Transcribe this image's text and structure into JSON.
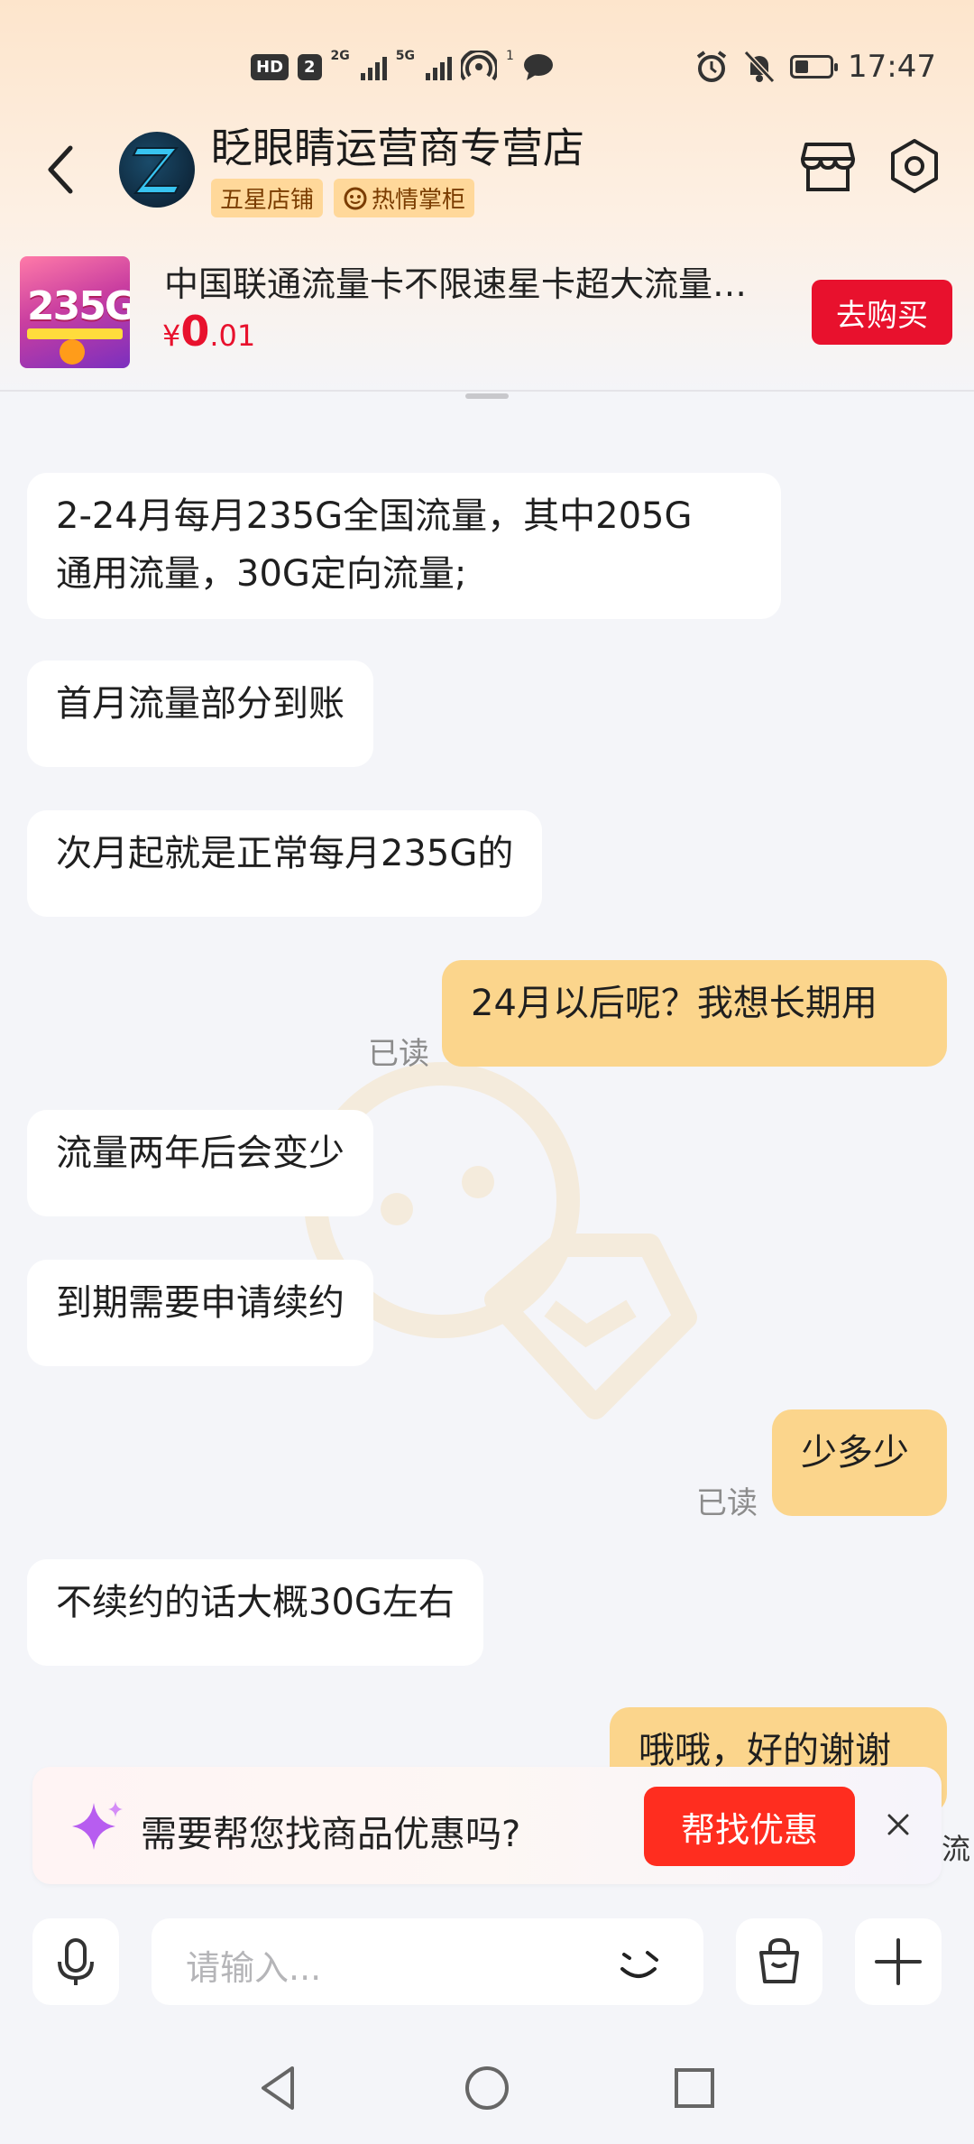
{
  "status_bar": {
    "time": "17:47",
    "hd_badge": "HD",
    "sim_num": "2",
    "net1": "2G",
    "net2": "5G",
    "hotspot_num": "1"
  },
  "header": {
    "shop_name": "眨眼睛运营商专营店",
    "tag1": "五星店铺",
    "tag2": "热情掌柜"
  },
  "product": {
    "title": "中国联通流量卡不限速星卡超大流量…",
    "price_symbol": "¥",
    "price_int": "0",
    "price_dec": ".01",
    "buy_label": "去购买",
    "img_text": "235G"
  },
  "messages": [
    {
      "side": "left",
      "line1": "2-24月每月235G全国流量，其中205G",
      "line2": "通用流量，30G定向流量;"
    },
    {
      "side": "left",
      "text": "首月流量部分到账"
    },
    {
      "side": "left",
      "text": "次月起就是正常每月235G的"
    },
    {
      "side": "right",
      "text": "24月以后呢？我想长期用",
      "status": "已读"
    },
    {
      "side": "left",
      "text": "流量两年后会变少"
    },
    {
      "side": "left",
      "text": "到期需要申请续约"
    },
    {
      "side": "right",
      "text": "少多少",
      "status": "已读"
    },
    {
      "side": "left",
      "text": "不续约的话大概30G左右"
    },
    {
      "side": "right",
      "text": "哦哦，好的谢谢"
    }
  ],
  "promo": {
    "text": "需要帮您找商品优惠吗?",
    "button": "帮找优惠",
    "side_text": "流"
  },
  "input": {
    "placeholder": "请输入..."
  },
  "colors": {
    "accent_red": "#e8112d",
    "promo_red": "#ff2d1f",
    "my_bubble": "#fbd58c",
    "tag_bg": "#ffd89a"
  }
}
